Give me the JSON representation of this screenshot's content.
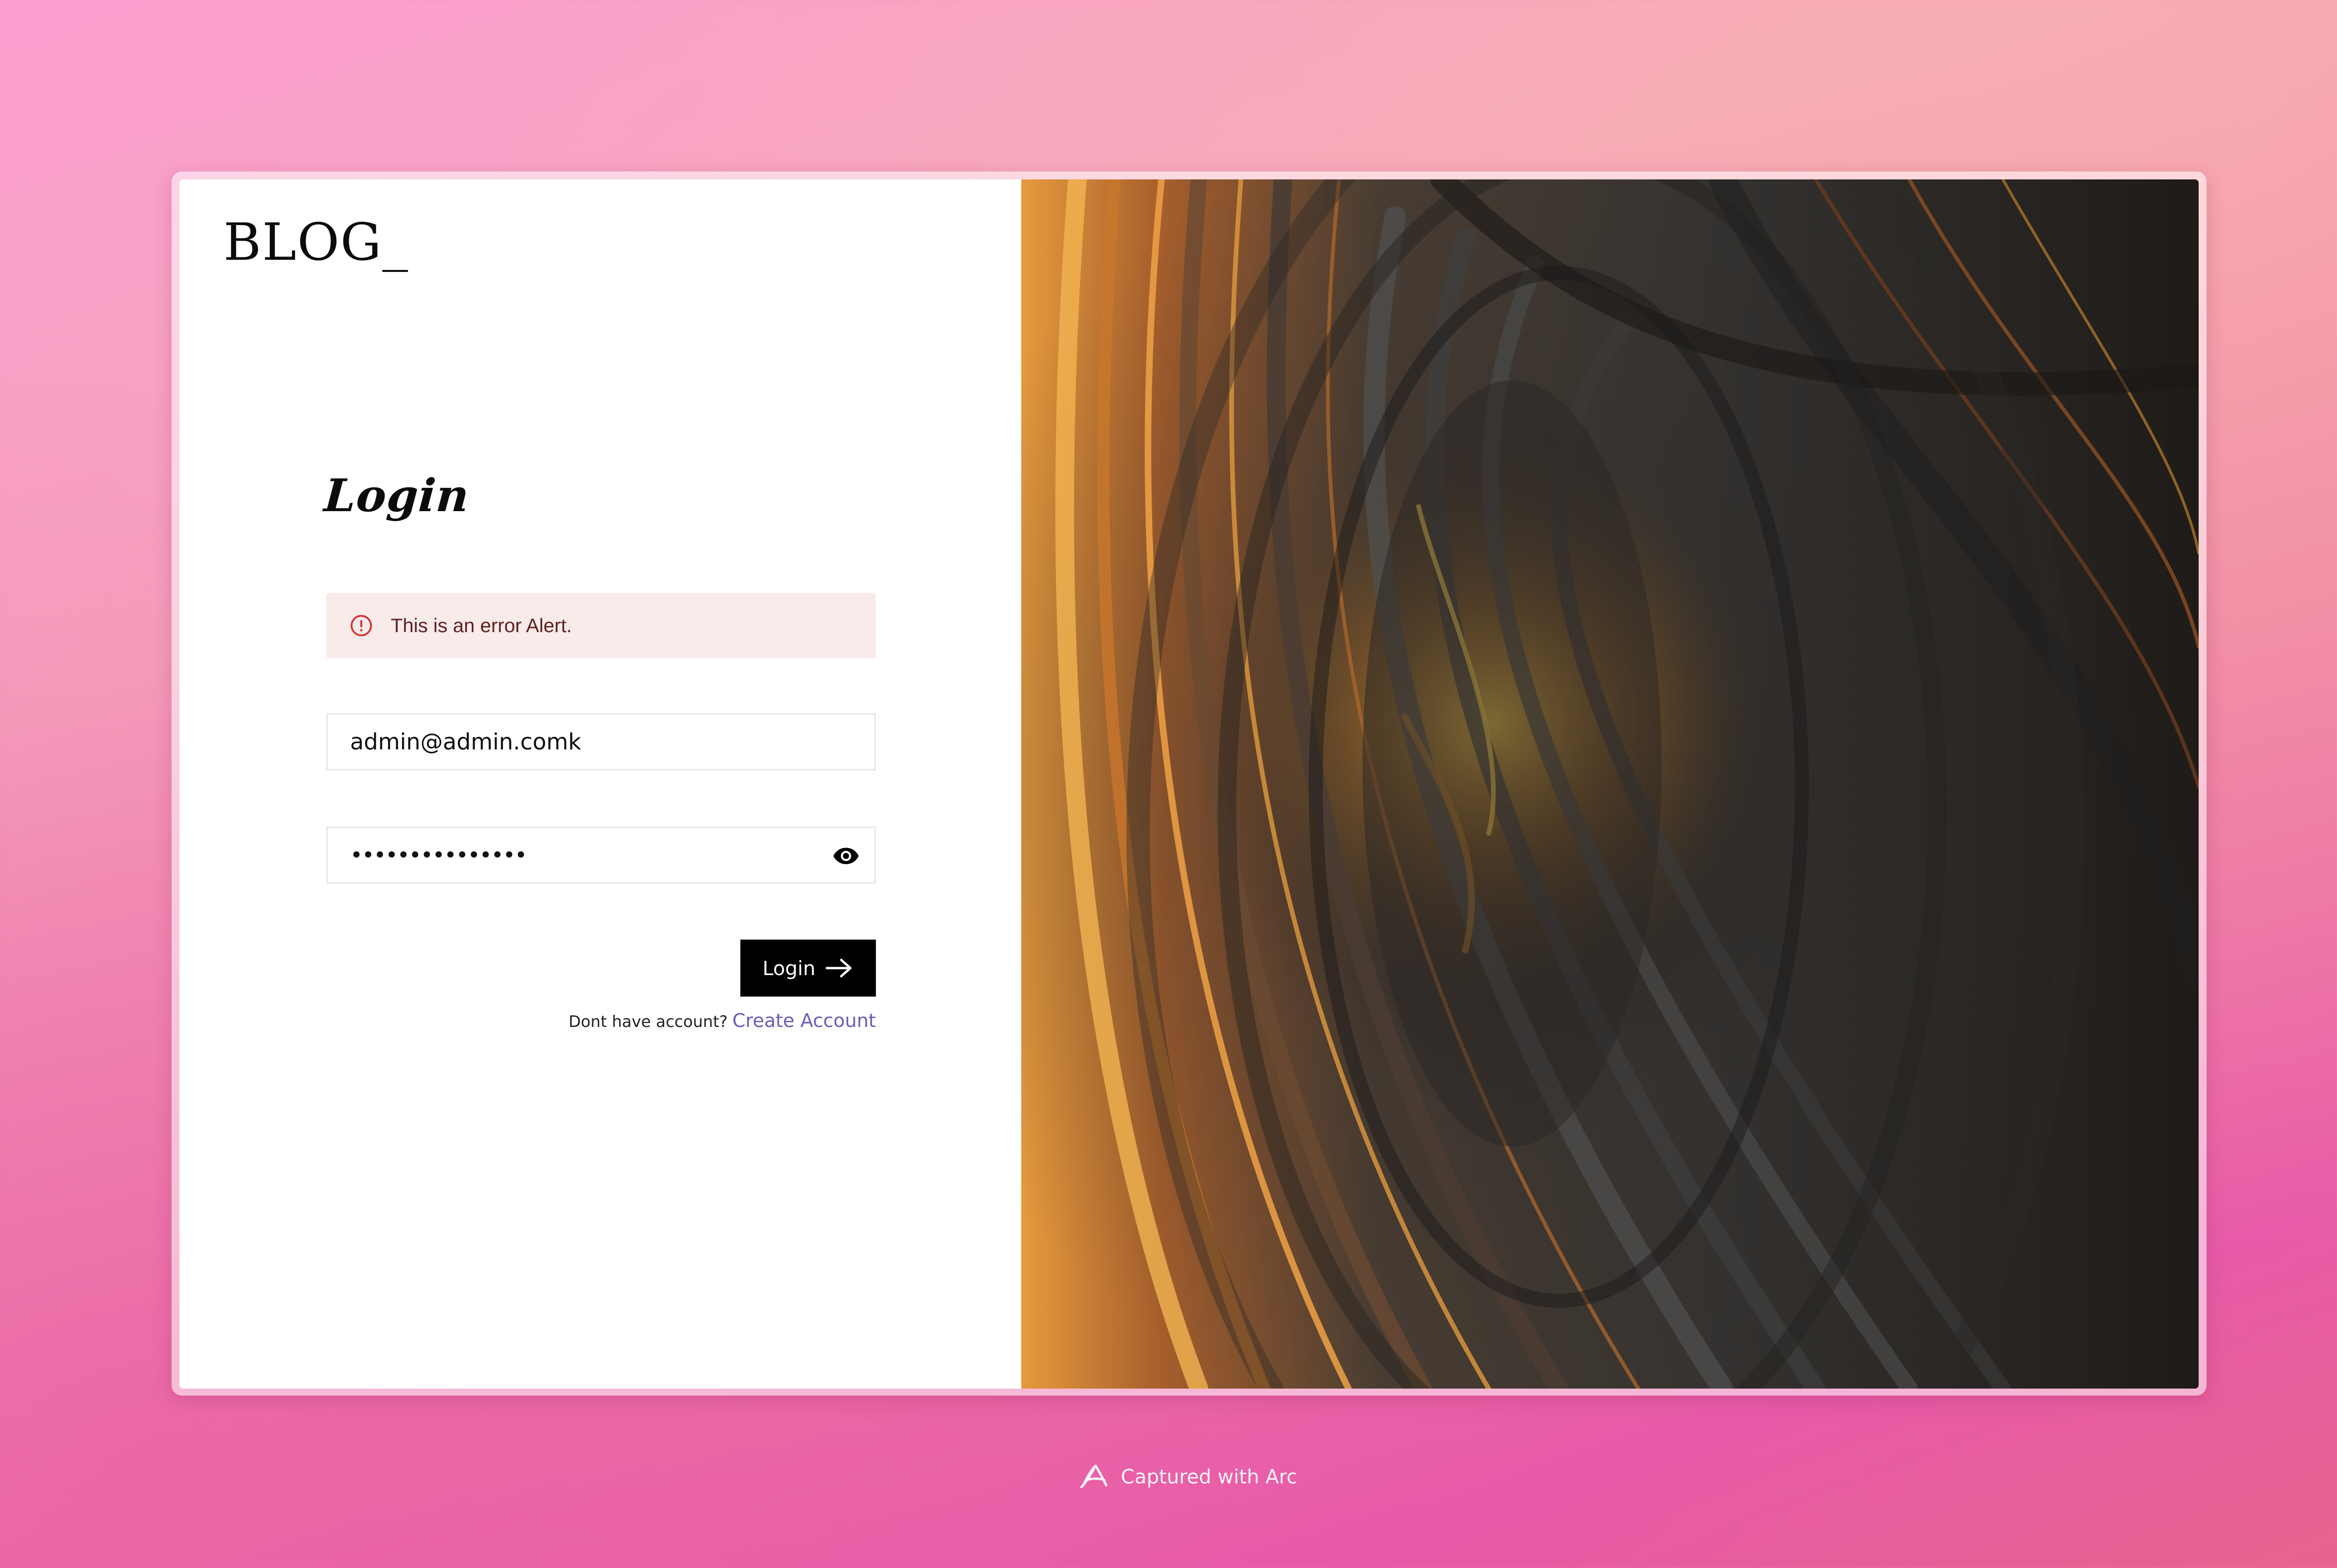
{
  "brand": {
    "logo_text": "BLOG_"
  },
  "login_form": {
    "title": "Login",
    "alert": {
      "message": "This is an error Alert.",
      "icon": "error-outline-icon",
      "color": "#d32f2f"
    },
    "email": {
      "value": "admin@admin.comk"
    },
    "password": {
      "masked_value": "•••••••••••••••",
      "visibility_icon": "eye-icon"
    },
    "submit": {
      "label": "Login",
      "icon": "arrow-right-icon"
    },
    "signup_prompt": {
      "text": "Dont have account?",
      "link_label": "Create Account",
      "link_color": "#6e5bb8"
    }
  },
  "hero_image": {
    "description_icon": "abstract-swirl-image"
  },
  "footer": {
    "capture_label": "Captured with Arc",
    "icon": "arc-logo-icon"
  }
}
